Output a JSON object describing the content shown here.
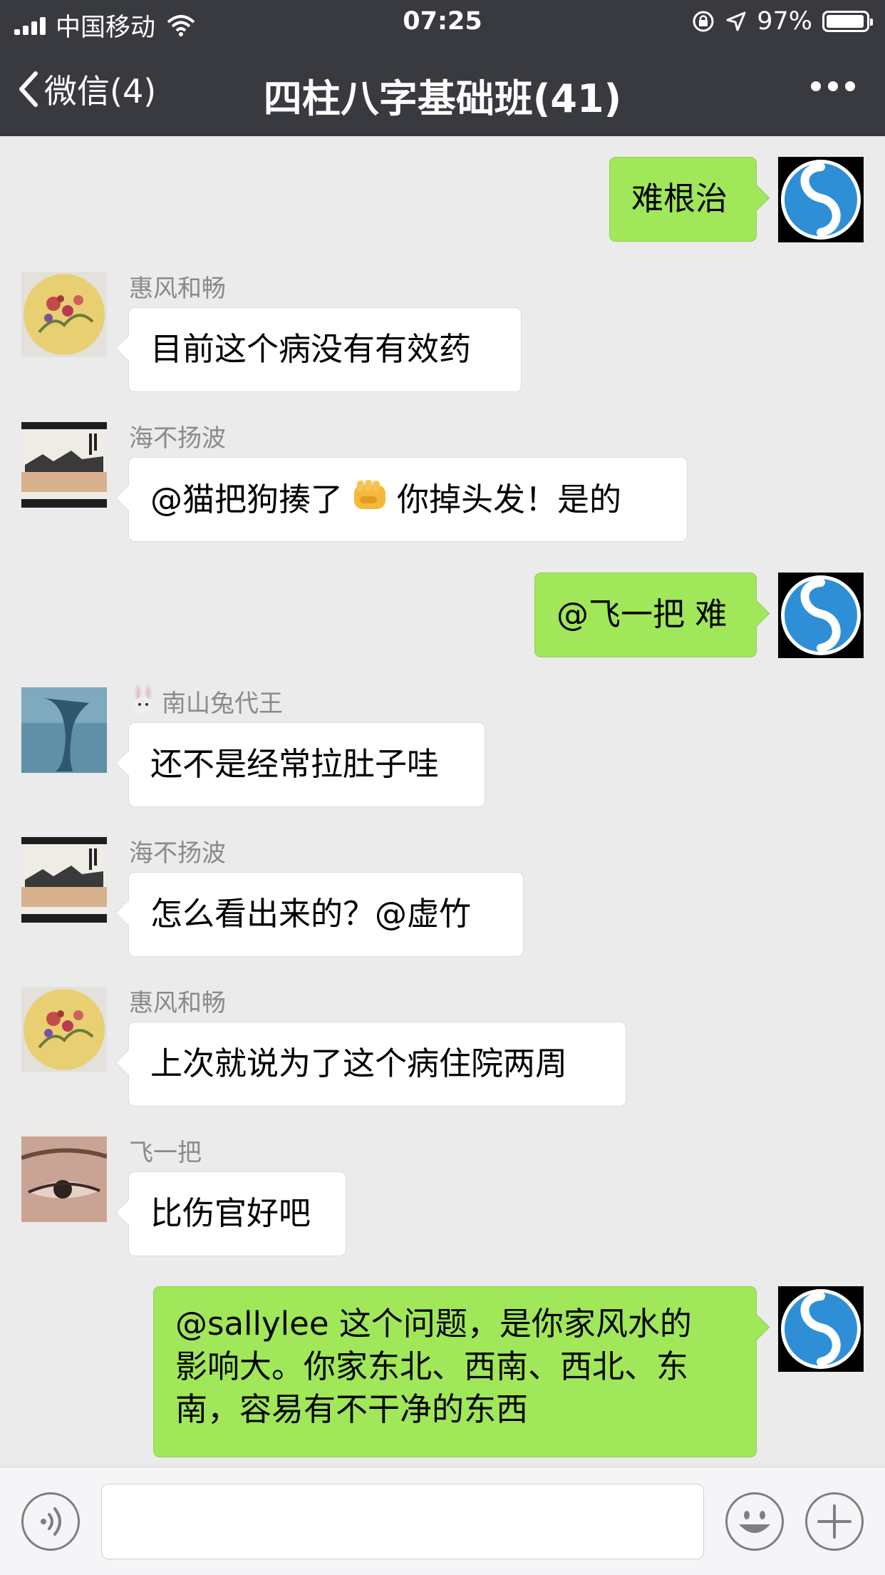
{
  "status_bar": {
    "carrier": "中国移动",
    "time": "07:25",
    "battery": "97%",
    "battery_level": 0.97
  },
  "nav": {
    "back_label": "微信(4)",
    "title": "四柱八字基础班(41)"
  },
  "messages": [
    {
      "side": "out",
      "text": "难根治",
      "avatar": "logo-avatar"
    },
    {
      "side": "in",
      "sender": "惠风和畅",
      "text": "目前这个病没有有效药",
      "avatar": "flower-painting-avatar"
    },
    {
      "side": "in",
      "sender": "海不扬波",
      "text_before": "@猫把狗揍了",
      "emoji": "fist-emoji",
      "text_after": "你掉头发！是的",
      "avatar": "landscape-scroll-avatar"
    },
    {
      "side": "out",
      "text": "@飞一把 难",
      "avatar": "logo-avatar"
    },
    {
      "side": "in",
      "sender": "南山兔代王",
      "sender_emoji": "rabbit-emoji",
      "text": "还不是经常拉肚子哇",
      "avatar": "whale-avatar"
    },
    {
      "side": "in",
      "sender": "海不扬波",
      "text": "怎么看出来的？@虚竹",
      "avatar": "landscape-scroll-avatar"
    },
    {
      "side": "in",
      "sender": "惠风和畅",
      "text": "上次就说为了这个病住院两周",
      "avatar": "flower-painting-avatar"
    },
    {
      "side": "in",
      "sender": "飞一把",
      "text": "比伤官好吧",
      "avatar": "eye-photo-avatar"
    },
    {
      "side": "out",
      "lines": [
        "@sallylee 这个问题，是你家风水的",
        "影响大。你家东北、西南、西北、东",
        "南，容易有不干净的东西"
      ],
      "avatar": "logo-avatar"
    }
  ],
  "input": {
    "placeholder": ""
  },
  "colors": {
    "header": "#393a3f",
    "chat_bg": "#ebebeb",
    "outgoing_bubble": "#a0e75a",
    "incoming_bubble": "#ffffff"
  },
  "icons": [
    "back-chevron-icon",
    "more-icon",
    "voice-icon",
    "emoji-icon",
    "plus-icon",
    "signal-icon",
    "wifi-icon",
    "lock-rotation-icon",
    "location-icon",
    "battery-icon"
  ]
}
